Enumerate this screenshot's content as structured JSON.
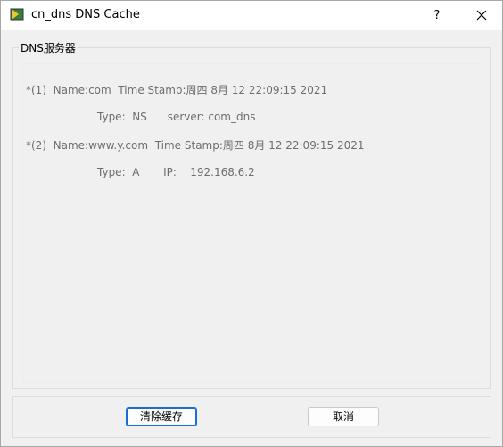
{
  "window": {
    "title": "cn_dns DNS Cache",
    "help_label": "?"
  },
  "group": {
    "label": "DNS服务器"
  },
  "entries": [
    {
      "line1": "*(1)  Name:com  Time Stamp:周四 8月 12 22:09:15 2021",
      "line2": "Type:  NS      server: com_dns"
    },
    {
      "line1": "*(2)  Name:www.y.com  Time Stamp:周四 8月 12 22:09:15 2021",
      "line2": "Type:  A       IP:    192.168.6.2"
    }
  ],
  "buttons": {
    "clear_cache": "清除缓存",
    "cancel": "取消"
  },
  "colors": {
    "primary_border": "#1a6dd1",
    "text_gray": "#6e6e6e"
  }
}
